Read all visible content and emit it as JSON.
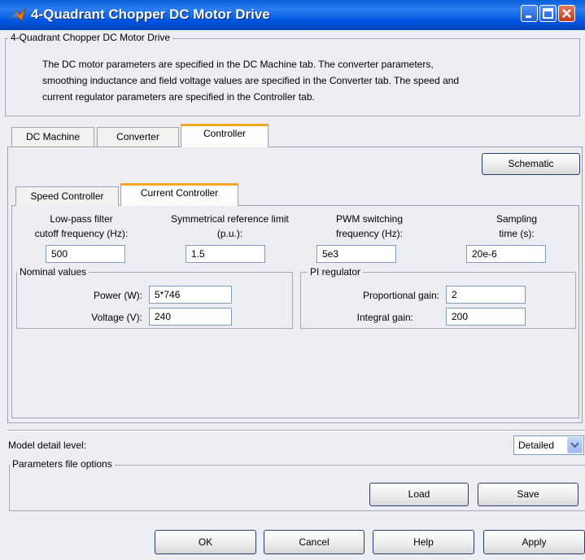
{
  "window": {
    "title": "4-Quadrant Chopper DC Motor Drive"
  },
  "block": {
    "group_title": "4-Quadrant Chopper DC Motor Drive",
    "description_lines": [
      "The DC motor parameters are specified in the DC Machine tab. The converter parameters,",
      "smoothing inductance and field voltage values are specified in the Converter tab. The speed and",
      "current regulator parameters are specified in the Controller tab."
    ]
  },
  "main_tabs": [
    "DC Machine",
    "Converter",
    "Controller"
  ],
  "schematic_label": "Schematic",
  "sub_tabs": [
    "Speed Controller",
    "Current Controller"
  ],
  "fields": {
    "lowpass": {
      "label_lines": [
        "Low-pass filter",
        "cutoff frequency (Hz):"
      ],
      "value": "500"
    },
    "symref": {
      "label_lines": [
        "Symmetrical reference limit",
        "(p.u.):"
      ],
      "value": "1.5"
    },
    "pwm": {
      "label_lines": [
        "PWM switching",
        "frequency (Hz):"
      ],
      "value": "5e3"
    },
    "sampling": {
      "label_lines": [
        "Sampling",
        "time (s):"
      ],
      "value": "20e-6"
    }
  },
  "nominal": {
    "title": "Nominal values",
    "power_label": "Power (W):",
    "power_value": "5*746",
    "voltage_label": "Voltage (V):",
    "voltage_value": "240"
  },
  "pi": {
    "title": "PI regulator",
    "kp_label": "Proportional gain:",
    "kp_value": "2",
    "ki_label": "Integral gain:",
    "ki_value": "200"
  },
  "model_detail": {
    "label": "Model detail level:",
    "value": "Detailed"
  },
  "params_file": {
    "title": "Parameters file options",
    "load": "Load",
    "save": "Save"
  },
  "buttons": {
    "ok": "OK",
    "cancel": "Cancel",
    "help": "Help",
    "apply": "Apply"
  },
  "colors": {
    "title_bar": "#0055e3",
    "active_tab_accent": "#f5a623",
    "dialog_bg": "#eceef4"
  }
}
